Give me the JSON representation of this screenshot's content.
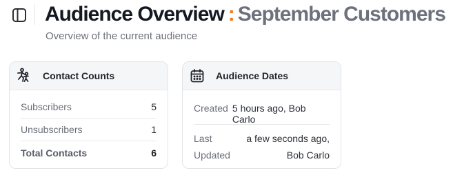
{
  "header": {
    "title": "Audience Overview",
    "separator": ":",
    "audience_name": "September Customers",
    "subtitle": "Overview of the current audience",
    "sidebar_toggle_icon": "sidebar-panel-icon"
  },
  "contact_counts": {
    "title": "Contact Counts",
    "icon": "people-running-icon",
    "rows": [
      {
        "label": "Subscribers",
        "value": "5"
      },
      {
        "label": "Unsubscribers",
        "value": "1"
      }
    ],
    "total": {
      "label": "Total Contacts",
      "value": "6"
    }
  },
  "audience_dates": {
    "title": "Audience Dates",
    "icon": "calendar-icon",
    "created": {
      "label": "Created",
      "value": "5 hours ago, Bob Carlo"
    },
    "last_updated": {
      "label_line1": "Last",
      "label_line2": "Updated",
      "value_line1": "a few seconds ago,",
      "value_line2": "Bob Carlo"
    }
  },
  "colors": {
    "accent": "#f27a1a",
    "title": "#141821",
    "audience_name": "#6d717c"
  }
}
